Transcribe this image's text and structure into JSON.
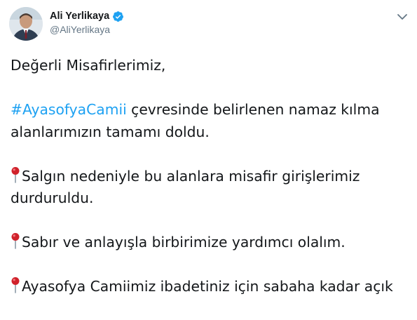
{
  "author": {
    "display_name": "Ali Yerlikaya",
    "handle": "@AliYerlikaya",
    "verified": true
  },
  "icons": {
    "verified": "verified-badge-icon",
    "menu": "chevron-down-icon",
    "pin": "round-pushpin-icon"
  },
  "colors": {
    "link": "#1da1f2",
    "text": "#14171a",
    "secondary": "#657786",
    "pin_red": "#d0212a"
  },
  "tweet": {
    "greeting": "Değerli Misafirlerimiz,",
    "para1": {
      "hashtag": "#AyasofyaCamii",
      "text": " çevresinde belirlenen namaz kılma alanlarımızın tamamı doldu."
    },
    "para2": "Salgın nedeniyle bu alanlara misafir girişlerimiz durduruldu.",
    "para3": "Sabır ve anlayışla birbirimize yardımcı olalım.",
    "para4": "Ayasofya Camiimiz ibadetiniz için sabaha kadar açık"
  }
}
